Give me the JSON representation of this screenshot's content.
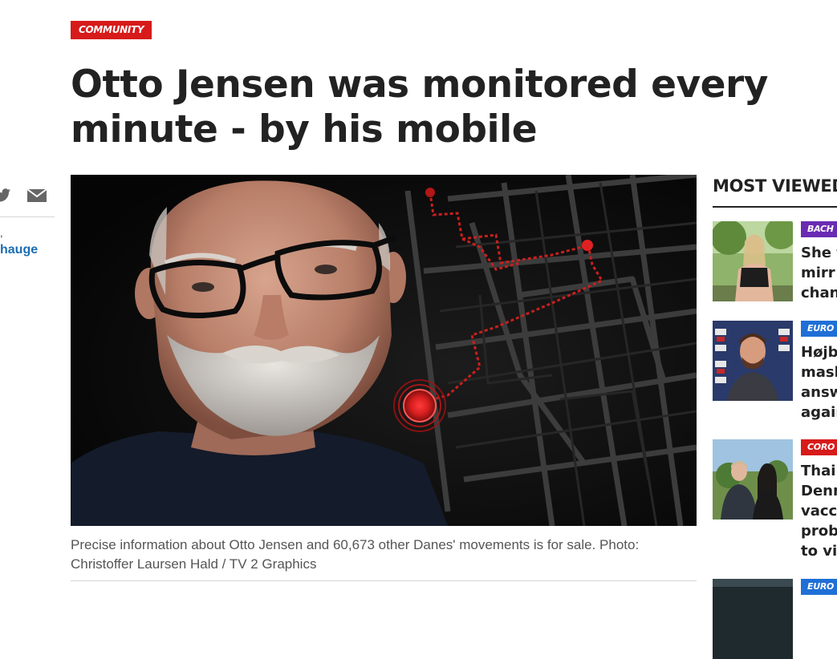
{
  "article": {
    "category": "COMMUNITY",
    "headline": "Otto Jensen was monitored every minute - by his mobile",
    "caption": "Precise information about Otto Jensen and 60,673 other Danes' movements is for sale. Photo: Christoffer Laursen Hald / TV 2 Graphics",
    "byline_prefix": ",",
    "byline_name": "hauge"
  },
  "share": {
    "icons": [
      "twitter-icon",
      "mail-icon"
    ]
  },
  "most_viewed": {
    "title": "MOST VIEWED",
    "items": [
      {
        "tag": "BACH",
        "tag_color": "#6a2bb3",
        "headline": "She f\nmirr\nchan"
      },
      {
        "tag": "EURO",
        "tag_color": "#1f6fd6",
        "headline": "Højb\nmask\nansw\nagain"
      },
      {
        "tag": "CORO",
        "tag_color": "#d71a1a",
        "headline": "Thai\nDenm\nvacci\nprob\nto vis"
      },
      {
        "tag": "EURO",
        "tag_color": "#1f6fd6",
        "headline": ""
      }
    ]
  },
  "colors": {
    "category_red": "#d71a1a",
    "link_blue": "#1b6cb3",
    "route_red": "#c8201e"
  }
}
